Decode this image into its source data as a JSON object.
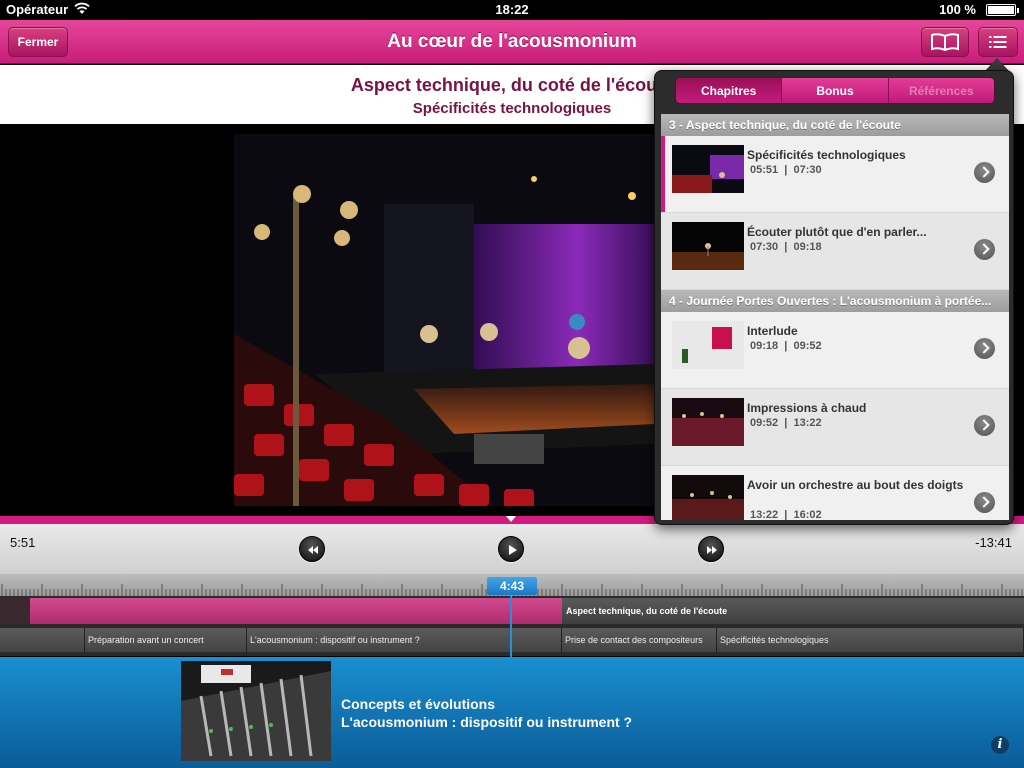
{
  "status": {
    "carrier": "Opérateur",
    "time": "18:22",
    "battery": "100 %"
  },
  "nav": {
    "close_label": "Fermer",
    "title": "Au cœur de l'acousmonium",
    "book_icon": "book-icon",
    "list_icon": "list-icon"
  },
  "header": {
    "chapter": "Aspect technique, du coté de l'écoute",
    "subchapter": "Spécificités technologiques"
  },
  "player": {
    "elapsed": "5:51",
    "remaining": "-13:41",
    "playhead": "4:43"
  },
  "timeline": {
    "track1_label": "Aspect technique, du coté de l'écoute",
    "track2": [
      "Préparation avant un concert",
      "L'acousmonium : dispositif ou instrument ?",
      "Prise de contact des compositeurs",
      "Spécificités technologiques"
    ]
  },
  "bottom": {
    "line1": "Concepts et évolutions",
    "line2": "L'acousmonium : dispositif ou instrument ?"
  },
  "popover": {
    "tabs": [
      "Chapitres",
      "Bonus",
      "Références"
    ],
    "sections": [
      {
        "header": "3 - Aspect technique, du coté de l'écoute",
        "items": [
          {
            "title": "Spécificités technologiques",
            "start": "05:51",
            "end": "07:30"
          },
          {
            "title": "Écouter plutôt que d'en parler...",
            "start": "07:30",
            "end": "09:18"
          }
        ]
      },
      {
        "header": "4 - Journée Portes Ouvertes : L'acousmonium à portée...",
        "items": [
          {
            "title": "Interlude",
            "start": "09:18",
            "end": "09:52"
          },
          {
            "title": "Impressions à chaud",
            "start": "09:52",
            "end": "13:22"
          },
          {
            "title": "Avoir un orchestre au bout des doigts",
            "start": "13:22",
            "end": "16:02"
          }
        ]
      }
    ],
    "time_separator": "|"
  },
  "colors": {
    "accent": "#d41a82",
    "bottom_blue": "#1a8fd0",
    "playhead_blue": "#2a8fd6"
  }
}
